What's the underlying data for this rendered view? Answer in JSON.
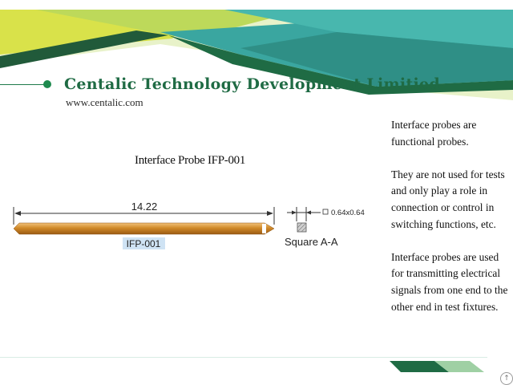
{
  "header": {
    "company_name": "Centalic Technology Development Limitied",
    "website": "www.centalic.com"
  },
  "drawing": {
    "title": "Interface Probe IFP-001",
    "length_dimension": "14.22",
    "part_label": "IFP-001",
    "section_dimension": "0.64x0.64",
    "section_label": "Square  A-A"
  },
  "description": {
    "paragraphs": [
      "Interface probes are functional probes.",
      "They are not used for tests and only play a role in connection or control in switching functions, etc.",
      "Interface probes are used for transmitting electrical signals from one end to the other end in test fixtures."
    ]
  },
  "colors": {
    "brand_green": "#1f6b44",
    "banner_teal": "#3aa6a0",
    "banner_lime": "#d6e04a",
    "probe_copper": "#d08a2a"
  }
}
